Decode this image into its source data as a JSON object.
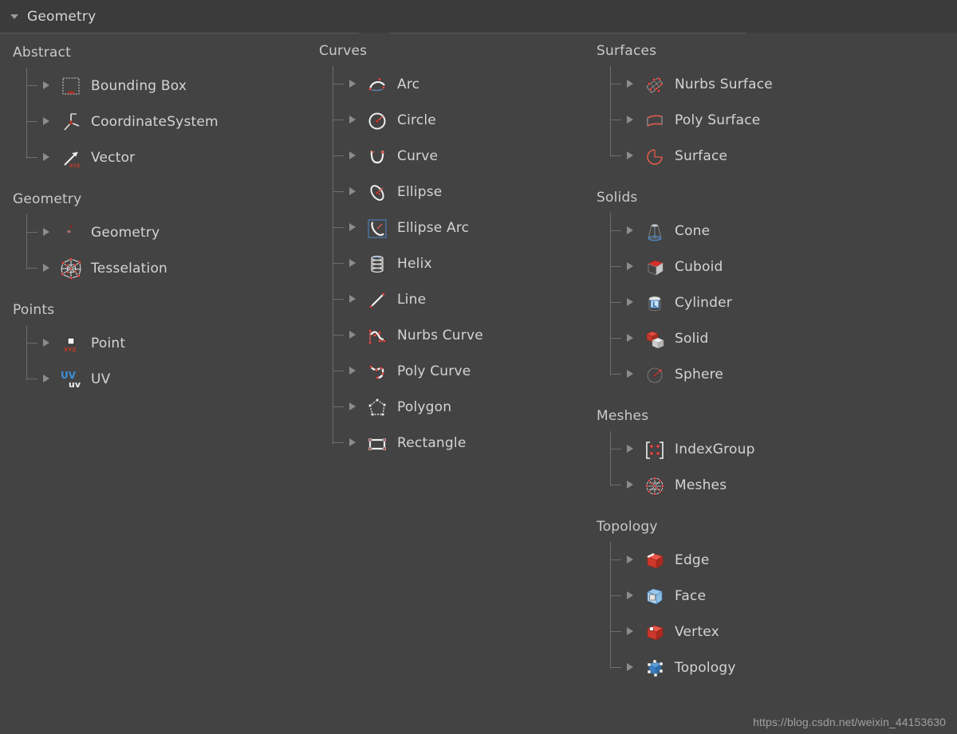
{
  "header": {
    "title": "Geometry",
    "disclosure_icon": "triangle-down-icon"
  },
  "watermark": "https://blog.csdn.net/weixin_44153630",
  "colors": {
    "background": "#434343",
    "header_background": "#3b3b3b",
    "text": "#d4d4d4",
    "group_title": "#c9c9c9",
    "tree_line": "#6e6e6e",
    "arrow": "#8c8c8c",
    "accent_red": "#c0392b",
    "accent_blue": "#3b7fc4"
  },
  "columns": [
    {
      "name": "column-left",
      "groups": [
        {
          "title": "Abstract",
          "items": [
            {
              "label": "Bounding Box",
              "icon": "bounding-box-icon"
            },
            {
              "label": "CoordinateSystem",
              "icon": "coordinate-system-icon"
            },
            {
              "label": "Vector",
              "icon": "vector-icon"
            }
          ]
        },
        {
          "title": "Geometry",
          "items": [
            {
              "label": "Geometry",
              "icon": "geometry-icon"
            },
            {
              "label": "Tesselation",
              "icon": "tesselation-icon"
            }
          ]
        },
        {
          "title": "Points",
          "items": [
            {
              "label": "Point",
              "icon": "point-icon"
            },
            {
              "label": "UV",
              "icon": "uv-icon"
            }
          ]
        }
      ]
    },
    {
      "name": "column-middle",
      "groups": [
        {
          "title": "Curves",
          "items": [
            {
              "label": "Arc",
              "icon": "arc-icon"
            },
            {
              "label": "Circle",
              "icon": "circle-icon"
            },
            {
              "label": "Curve",
              "icon": "curve-icon"
            },
            {
              "label": "Ellipse",
              "icon": "ellipse-icon"
            },
            {
              "label": "Ellipse Arc",
              "icon": "ellipse-arc-icon"
            },
            {
              "label": "Helix",
              "icon": "helix-icon"
            },
            {
              "label": "Line",
              "icon": "line-icon"
            },
            {
              "label": "Nurbs Curve",
              "icon": "nurbs-curve-icon"
            },
            {
              "label": "Poly Curve",
              "icon": "poly-curve-icon"
            },
            {
              "label": "Polygon",
              "icon": "polygon-icon"
            },
            {
              "label": "Rectangle",
              "icon": "rectangle-icon"
            }
          ]
        }
      ]
    },
    {
      "name": "column-right",
      "groups": [
        {
          "title": "Surfaces",
          "items": [
            {
              "label": "Nurbs Surface",
              "icon": "nurbs-surface-icon"
            },
            {
              "label": "Poly Surface",
              "icon": "poly-surface-icon"
            },
            {
              "label": "Surface",
              "icon": "surface-icon"
            }
          ]
        },
        {
          "title": "Solids",
          "items": [
            {
              "label": "Cone",
              "icon": "cone-icon"
            },
            {
              "label": "Cuboid",
              "icon": "cuboid-icon"
            },
            {
              "label": "Cylinder",
              "icon": "cylinder-icon"
            },
            {
              "label": "Solid",
              "icon": "solid-icon"
            },
            {
              "label": "Sphere",
              "icon": "sphere-icon"
            }
          ]
        },
        {
          "title": "Meshes",
          "items": [
            {
              "label": "IndexGroup",
              "icon": "index-group-icon"
            },
            {
              "label": "Meshes",
              "icon": "meshes-icon"
            }
          ]
        },
        {
          "title": "Topology",
          "items": [
            {
              "label": "Edge",
              "icon": "edge-icon"
            },
            {
              "label": "Face",
              "icon": "face-icon"
            },
            {
              "label": "Vertex",
              "icon": "vertex-icon"
            },
            {
              "label": "Topology",
              "icon": "topology-icon"
            }
          ]
        }
      ]
    }
  ]
}
